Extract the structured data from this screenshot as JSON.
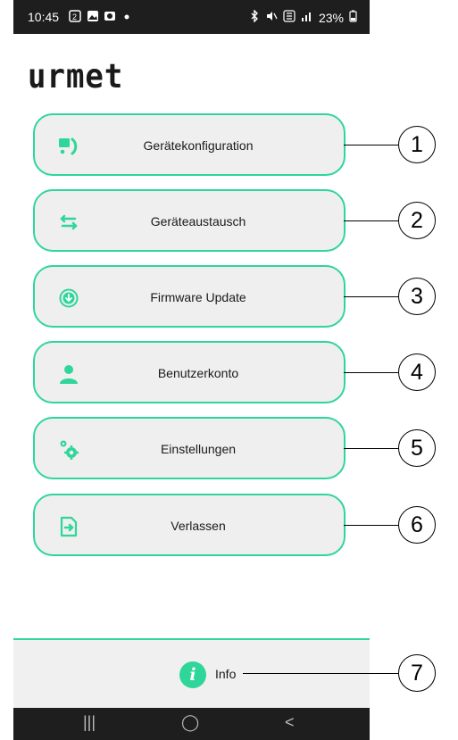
{
  "status_bar": {
    "time": "10:45",
    "left_icons": [
      "sim-icon",
      "image-icon",
      "camera-icon",
      "dot-icon"
    ],
    "right_icons": [
      "bluetooth-icon",
      "mute-icon",
      "5g-icon",
      "signal-icon"
    ],
    "battery": "23%"
  },
  "logo": {
    "text": "urmet"
  },
  "menu": [
    {
      "label": "Gerätekonfiguration",
      "icon": "device-config-icon"
    },
    {
      "label": "Geräteaustausch",
      "icon": "swap-arrows-icon"
    },
    {
      "label": "Firmware Update",
      "icon": "download-circle-icon"
    },
    {
      "label": "Benutzerkonto",
      "icon": "user-icon"
    },
    {
      "label": "Einstellungen",
      "icon": "gears-icon"
    },
    {
      "label": "Verlassen",
      "icon": "exit-icon"
    }
  ],
  "footer": {
    "info_label": "Info",
    "info_icon": "info-icon"
  },
  "nav_bar": {
    "recent": "|||",
    "home": "◯",
    "back": "<"
  },
  "callouts": [
    "1",
    "2",
    "3",
    "4",
    "5",
    "6",
    "7"
  ],
  "colors": {
    "accent": "#2fd69a",
    "button_bg": "#efefef",
    "bar_bg": "#1e1e1e"
  }
}
